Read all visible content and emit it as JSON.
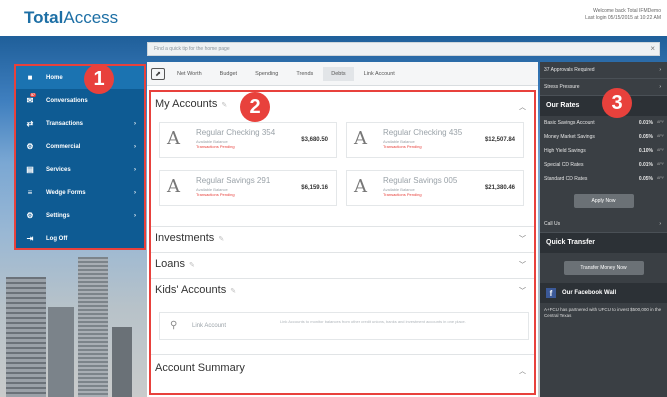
{
  "brand": {
    "name_bold": "Total",
    "name_light": "Access"
  },
  "welcome": {
    "line1": "Welcome back Total IFMDemo",
    "line2": "Last login 05/15/2015 at 10:22 AM"
  },
  "search": {
    "placeholder": "Find a quick tip for the home page"
  },
  "sidenav": {
    "items": [
      {
        "label": "Home",
        "icon": "home-icon",
        "glyph": "■",
        "arrow": ""
      },
      {
        "label": "Conversations",
        "icon": "envelope-icon",
        "glyph": "✉",
        "arrow": ""
      },
      {
        "label": "Transactions",
        "icon": "arrows-icon",
        "glyph": "⇄",
        "arrow": "›"
      },
      {
        "label": "Commercial",
        "icon": "gear-icon",
        "glyph": "⚙",
        "arrow": "›"
      },
      {
        "label": "Services",
        "icon": "document-icon",
        "glyph": "▤",
        "arrow": "›"
      },
      {
        "label": "Wedge Forms",
        "icon": "list-icon",
        "glyph": "≡",
        "arrow": "›"
      },
      {
        "label": "Settings",
        "icon": "settings-icon",
        "glyph": "⚙",
        "arrow": "›"
      },
      {
        "label": "Log Off",
        "icon": "logout-icon",
        "glyph": "⇥",
        "arrow": ""
      }
    ],
    "conversations_badge": "57"
  },
  "callouts": [
    "1",
    "2",
    "3"
  ],
  "tabs": [
    "Net Worth",
    "Budget",
    "Spending",
    "Trends",
    "Debts",
    "Link Account"
  ],
  "main": {
    "my_accounts_title": "My Accounts",
    "accounts": [
      {
        "name": "Regular Checking 354",
        "sub": "Available Balance",
        "pending": "Transactions Pending",
        "balance": "$3,680.50"
      },
      {
        "name": "Regular Checking 435",
        "sub": "Available Balance",
        "pending": "Transactions Pending",
        "balance": "$12,507.84"
      },
      {
        "name": "Regular Savings 291",
        "sub": "Available Balance",
        "pending": "Transactions Pending",
        "balance": "$6,159.16"
      },
      {
        "name": "Regular Savings 005",
        "sub": "Available Balance",
        "pending": "Transactions Pending",
        "balance": "$21,380.46"
      }
    ],
    "investments_title": "Investments",
    "loans_title": "Loans",
    "kids_title": "Kids' Accounts",
    "link_account_label": "Link Account",
    "link_account_desc": "Link Accounts to monitor balances from other credit unions, banks and investment accounts in one place.",
    "summary_title": "Account Summary"
  },
  "rightbar": {
    "approvals": "37 Approvals Required",
    "pending": "Stress Pressure",
    "rates_title": "Our Rates",
    "rates": [
      {
        "name": "Basic Savings Account",
        "value": "0.01%",
        "unit": "APY"
      },
      {
        "name": "Money Market Savings",
        "value": "0.05%",
        "unit": "APY"
      },
      {
        "name": "High Yield Savings",
        "value": "0.10%",
        "unit": "APY"
      },
      {
        "name": "Special CD Rates",
        "value": "0.01%",
        "unit": "APY"
      },
      {
        "name": "Standard CD Rates",
        "value": "0.05%",
        "unit": "APY"
      }
    ],
    "apply_now": "Apply Now",
    "call_us": "Call Us",
    "quick_transfer_title": "Quick Transfer",
    "transfer_button": "Transfer Money Now",
    "facebook_title": "Our Facebook Wall",
    "facebook_text": "A+FCU has partnered with UFCU to invest $500,000 in the Central Texas"
  },
  "colors": {
    "nav_bg": "#0e5b93",
    "callout": "#e8413c",
    "brand_blue": "#1d6fa5",
    "sidebar_bg": "#3a3f44"
  }
}
